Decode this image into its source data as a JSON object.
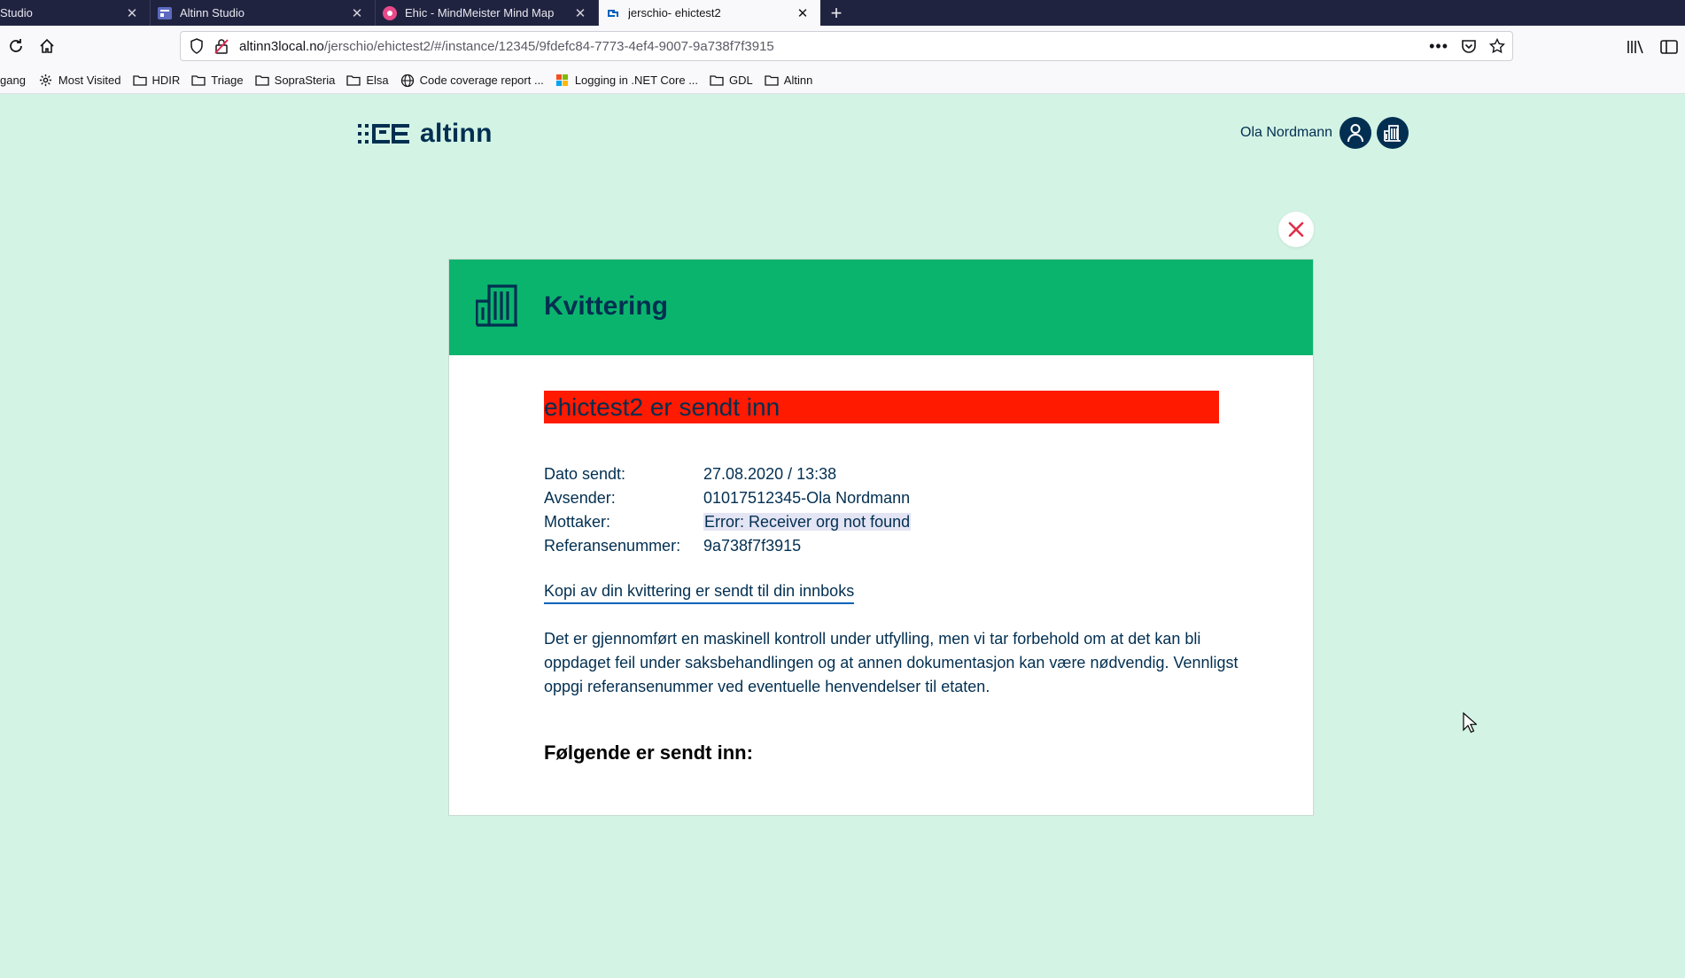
{
  "browser": {
    "tabs": [
      {
        "title": "Studio",
        "active": false
      },
      {
        "title": "Altinn Studio",
        "active": false
      },
      {
        "title": "Ehic - MindMeister Mind Map",
        "active": false
      },
      {
        "title": "jerschio- ehictest2",
        "active": true
      }
    ],
    "url": {
      "host": "altinn3local.no",
      "path": "/jerschio/ehictest2/#/instance/12345/9fdefc84-7773-4ef4-9007-9a738f7f3915"
    },
    "bookmarks": [
      {
        "label": "gang",
        "icon": "none"
      },
      {
        "label": "Most Visited",
        "icon": "gear-icon"
      },
      {
        "label": "HDIR",
        "icon": "folder-icon"
      },
      {
        "label": "Triage",
        "icon": "folder-icon"
      },
      {
        "label": "SopraSteria",
        "icon": "folder-icon"
      },
      {
        "label": "Elsa",
        "icon": "folder-icon"
      },
      {
        "label": "Code coverage report ...",
        "icon": "globe-icon"
      },
      {
        "label": "Logging in .NET Core ...",
        "icon": "windows-icon"
      },
      {
        "label": "GDL",
        "icon": "folder-icon"
      },
      {
        "label": "Altinn",
        "icon": "folder-icon"
      }
    ]
  },
  "header": {
    "logo_text": "altinn",
    "user_name": "Ola Nordmann"
  },
  "receipt": {
    "title": "Kvittering",
    "banner": "ehictest2 er sendt inn",
    "details": [
      {
        "label": "Dato sendt:",
        "value": "27.08.2020 / 13:38"
      },
      {
        "label": "Avsender:",
        "value": "01017512345-Ola Nordmann"
      },
      {
        "label": "Mottaker:",
        "value": "Error: Receiver org not found"
      },
      {
        "label": "Referansenummer:",
        "value": "9a738f7f3915"
      }
    ],
    "copy_link": "Kopi av din kvittering er sendt til din innboks",
    "disclaimer": "Det er gjennomført en maskinell kontroll under utfylling, men vi tar forbehold om at det kan bli oppdaget feil under saksbehandlingen og at annen dokumentasjon kan være nødvendig. Vennligst oppgi referansenummer ved eventuelle henvendelser til etaten.",
    "sent_heading": "Følgende er sendt inn:"
  },
  "colors": {
    "page_bg": "#d3f3e4",
    "header_green": "#0bb46d",
    "banner_red": "#ff1a00",
    "brand_navy": "#022f51",
    "close_red": "#e02e49"
  }
}
